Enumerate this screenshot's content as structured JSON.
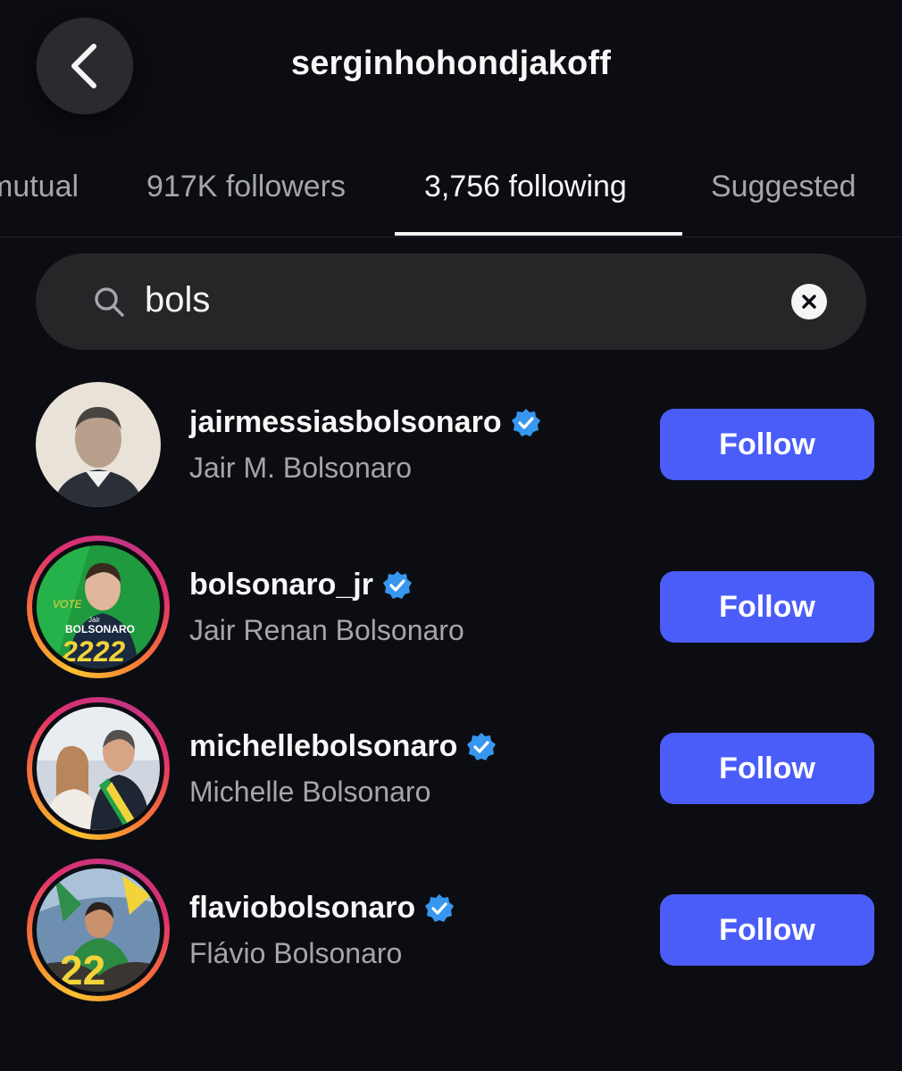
{
  "header": {
    "title": "serginhohondjakoff"
  },
  "tabs": [
    {
      "label": "mutual"
    },
    {
      "label": "917K followers"
    },
    {
      "label": "3,756 following",
      "active": true
    },
    {
      "label": "Suggested"
    }
  ],
  "search": {
    "value": "bols",
    "icon": "search-icon",
    "clear_icon": "clear-icon"
  },
  "users": [
    {
      "username": "jairmessiasbolsonaro",
      "full_name": "Jair M. Bolsonaro",
      "verified": true,
      "follow_label": "Follow",
      "story_ring": false
    },
    {
      "username": "bolsonaro_jr",
      "full_name": "Jair Renan Bolsonaro",
      "verified": true,
      "follow_label": "Follow",
      "story_ring": true,
      "avatar_text": {
        "vote": "VOTE",
        "top": "Jair",
        "name": "BOLSONARO",
        "number": "2222"
      }
    },
    {
      "username": "michellebolsonaro",
      "full_name": "Michelle Bolsonaro",
      "verified": true,
      "follow_label": "Follow",
      "story_ring": true
    },
    {
      "username": "flaviobolsonaro",
      "full_name": "Flávio Bolsonaro",
      "verified": true,
      "follow_label": "Follow",
      "story_ring": true,
      "avatar_text": {
        "number": "22"
      }
    }
  ],
  "colors": {
    "background": "#0c0d12",
    "follow_button": "#4a5df9",
    "verified_badge": "#3797f0",
    "secondary_text": "#a4a6ac"
  }
}
